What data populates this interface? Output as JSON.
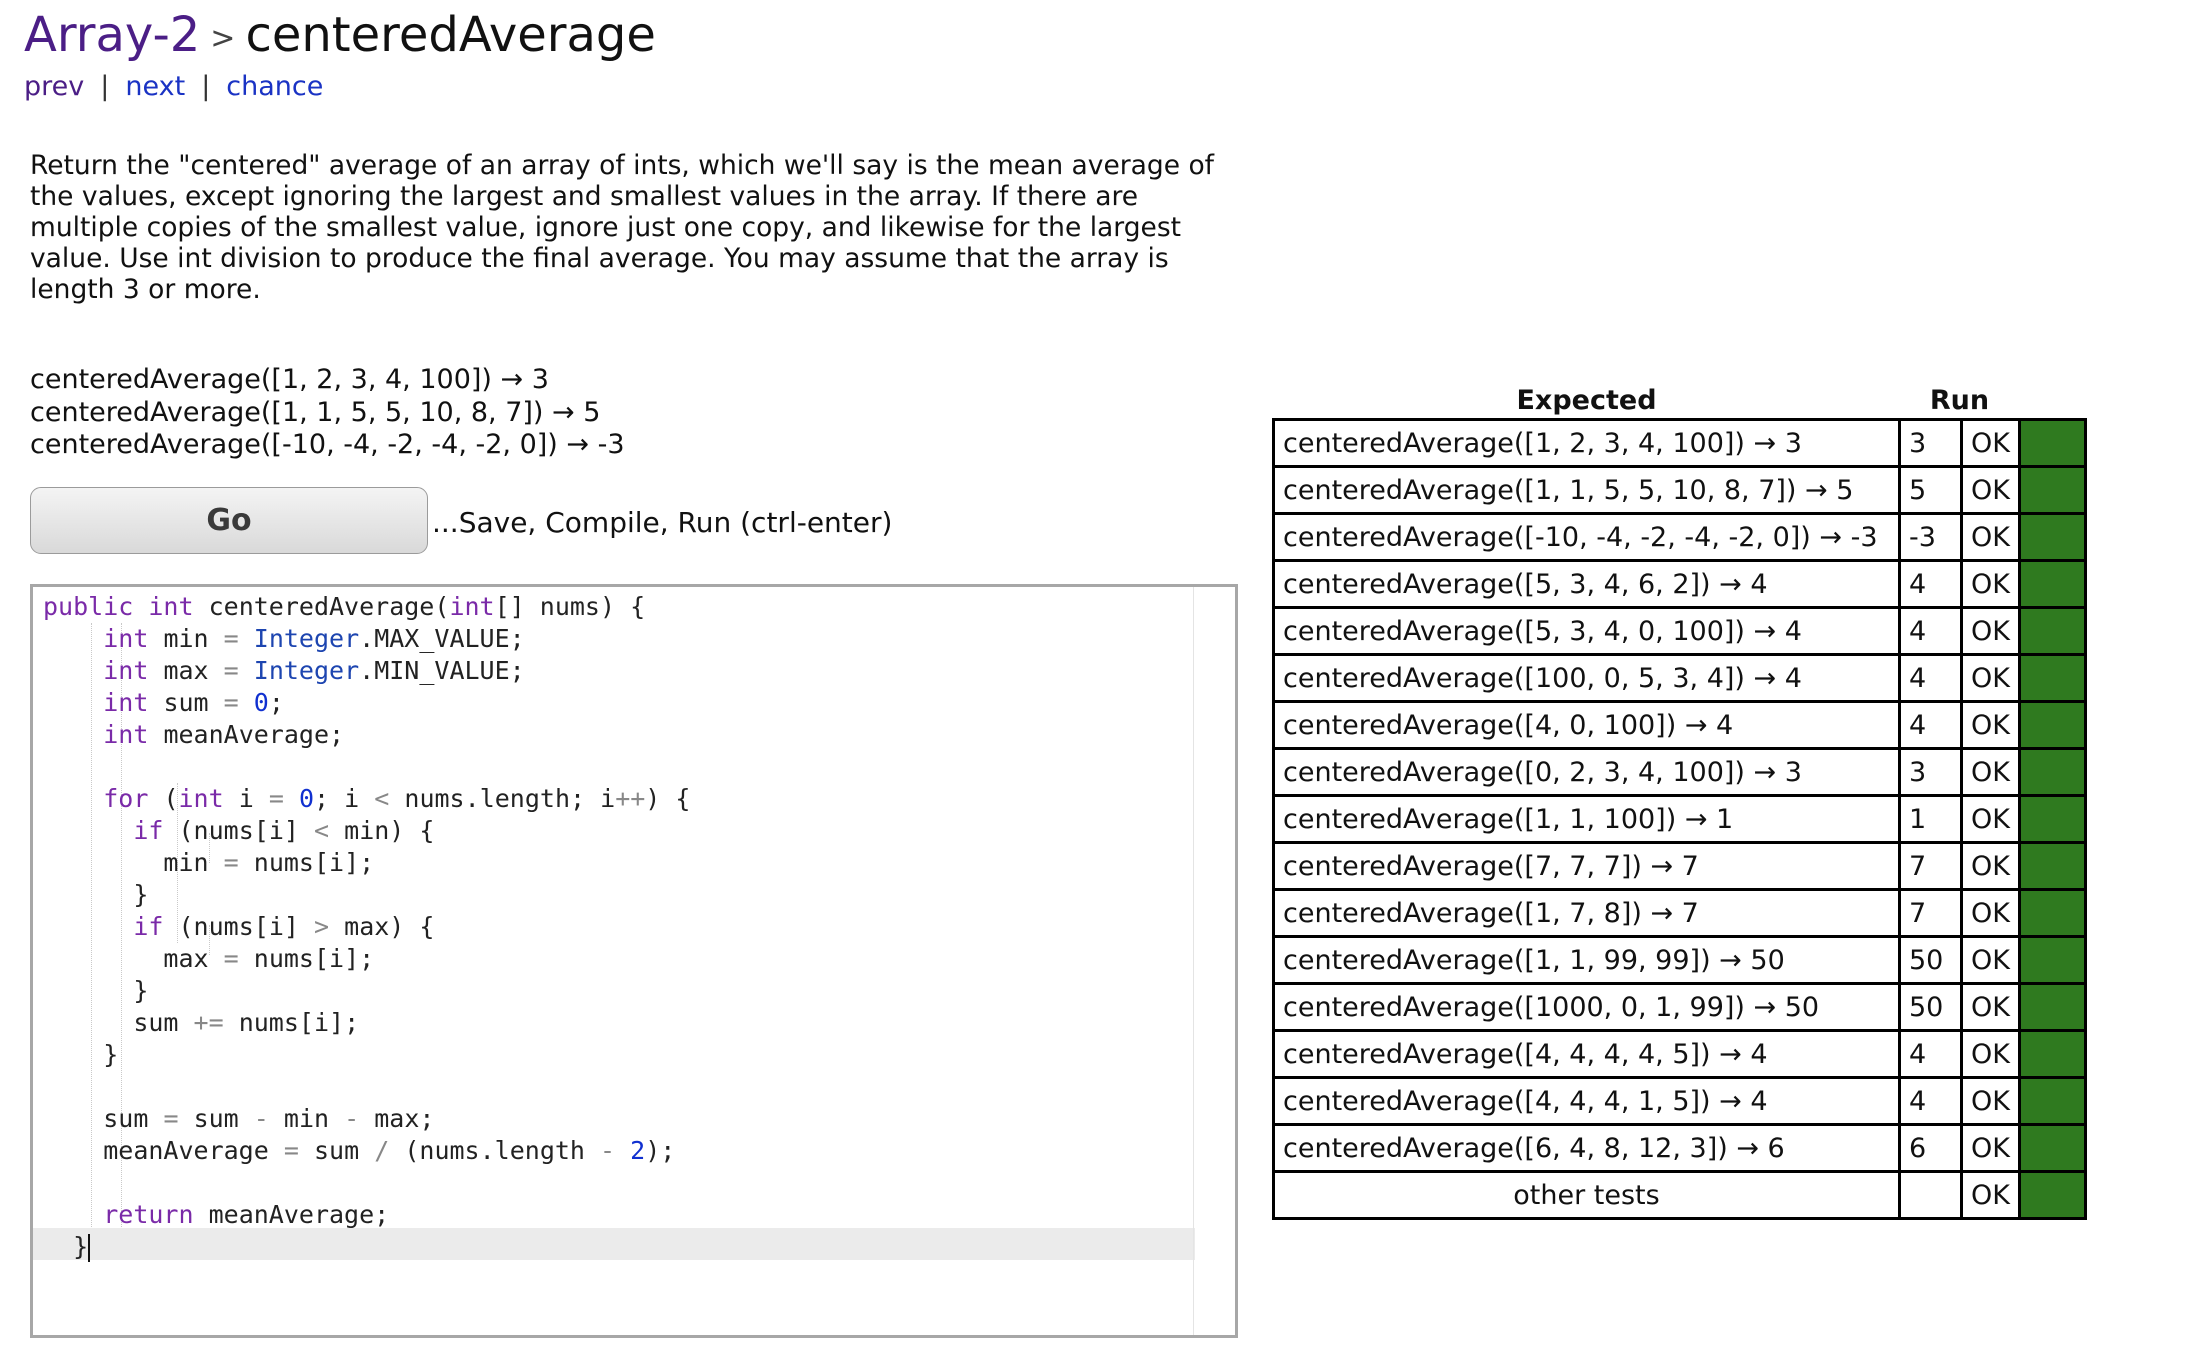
{
  "breadcrumb": {
    "section": "Array-2",
    "separator": ">",
    "title": "centeredAverage"
  },
  "nav": {
    "prev": "prev",
    "next": "next",
    "chance": "chance",
    "divider": "|"
  },
  "description": "Return the \"centered\" average of an array of ints, which we'll say is the mean average of the values, except ignoring the largest and smallest values in the array. If there are multiple copies of the smallest value, ignore just one copy, and likewise for the largest value. Use int division to produce the final average. You may assume that the array is length 3 or more.",
  "examples": [
    "centeredAverage([1, 2, 3, 4, 100]) → 3",
    "centeredAverage([1, 1, 5, 5, 10, 8, 7]) → 5",
    "centeredAverage([-10, -4, -2, -4, -2, 0]) → -3"
  ],
  "go_button": {
    "label": "Go",
    "hint": "...Save, Compile, Run (ctrl-enter)"
  },
  "code": [
    "public int centeredAverage(int[] nums) {",
    "    int min = Integer.MAX_VALUE;",
    "    int max = Integer.MIN_VALUE;",
    "    int sum = 0;",
    "    int meanAverage;",
    "",
    "    for (int i = 0; i < nums.length; i++) {",
    "      if (nums[i] < min) {",
    "        min = nums[i];",
    "      }",
    "      if (nums[i] > max) {",
    "        max = nums[i];",
    "      }",
    "      sum += nums[i];",
    "    }",
    "",
    "    sum = sum - min - max;",
    "    meanAverage = sum / (nums.length - 2);",
    "",
    "    return meanAverage;",
    "  }"
  ],
  "results": {
    "headers": {
      "expected": "Expected",
      "run": "Run"
    },
    "status_color": "#2f7a1f",
    "rows": [
      {
        "expected": "centeredAverage([1, 2, 3, 4, 100]) → 3",
        "run": "3",
        "status": "OK"
      },
      {
        "expected": "centeredAverage([1, 1, 5, 5, 10, 8, 7]) → 5",
        "run": "5",
        "status": "OK"
      },
      {
        "expected": "centeredAverage([-10, -4, -2, -4, -2, 0]) → -3",
        "run": "-3",
        "status": "OK"
      },
      {
        "expected": "centeredAverage([5, 3, 4, 6, 2]) → 4",
        "run": "4",
        "status": "OK"
      },
      {
        "expected": "centeredAverage([5, 3, 4, 0, 100]) → 4",
        "run": "4",
        "status": "OK"
      },
      {
        "expected": "centeredAverage([100, 0, 5, 3, 4]) → 4",
        "run": "4",
        "status": "OK"
      },
      {
        "expected": "centeredAverage([4, 0, 100]) → 4",
        "run": "4",
        "status": "OK"
      },
      {
        "expected": "centeredAverage([0, 2, 3, 4, 100]) → 3",
        "run": "3",
        "status": "OK"
      },
      {
        "expected": "centeredAverage([1, 1, 100]) → 1",
        "run": "1",
        "status": "OK"
      },
      {
        "expected": "centeredAverage([7, 7, 7]) → 7",
        "run": "7",
        "status": "OK"
      },
      {
        "expected": "centeredAverage([1, 7, 8]) → 7",
        "run": "7",
        "status": "OK"
      },
      {
        "expected": "centeredAverage([1, 1, 99, 99]) → 50",
        "run": "50",
        "status": "OK"
      },
      {
        "expected": "centeredAverage([1000, 0, 1, 99]) → 50",
        "run": "50",
        "status": "OK"
      },
      {
        "expected": "centeredAverage([4, 4, 4, 4, 5]) → 4",
        "run": "4",
        "status": "OK"
      },
      {
        "expected": "centeredAverage([4, 4, 4, 1, 5]) → 4",
        "run": "4",
        "status": "OK"
      },
      {
        "expected": "centeredAverage([6, 4, 8, 12, 3]) → 6",
        "run": "6",
        "status": "OK"
      }
    ],
    "other": {
      "label": "other tests",
      "run": "",
      "status": "OK"
    }
  }
}
